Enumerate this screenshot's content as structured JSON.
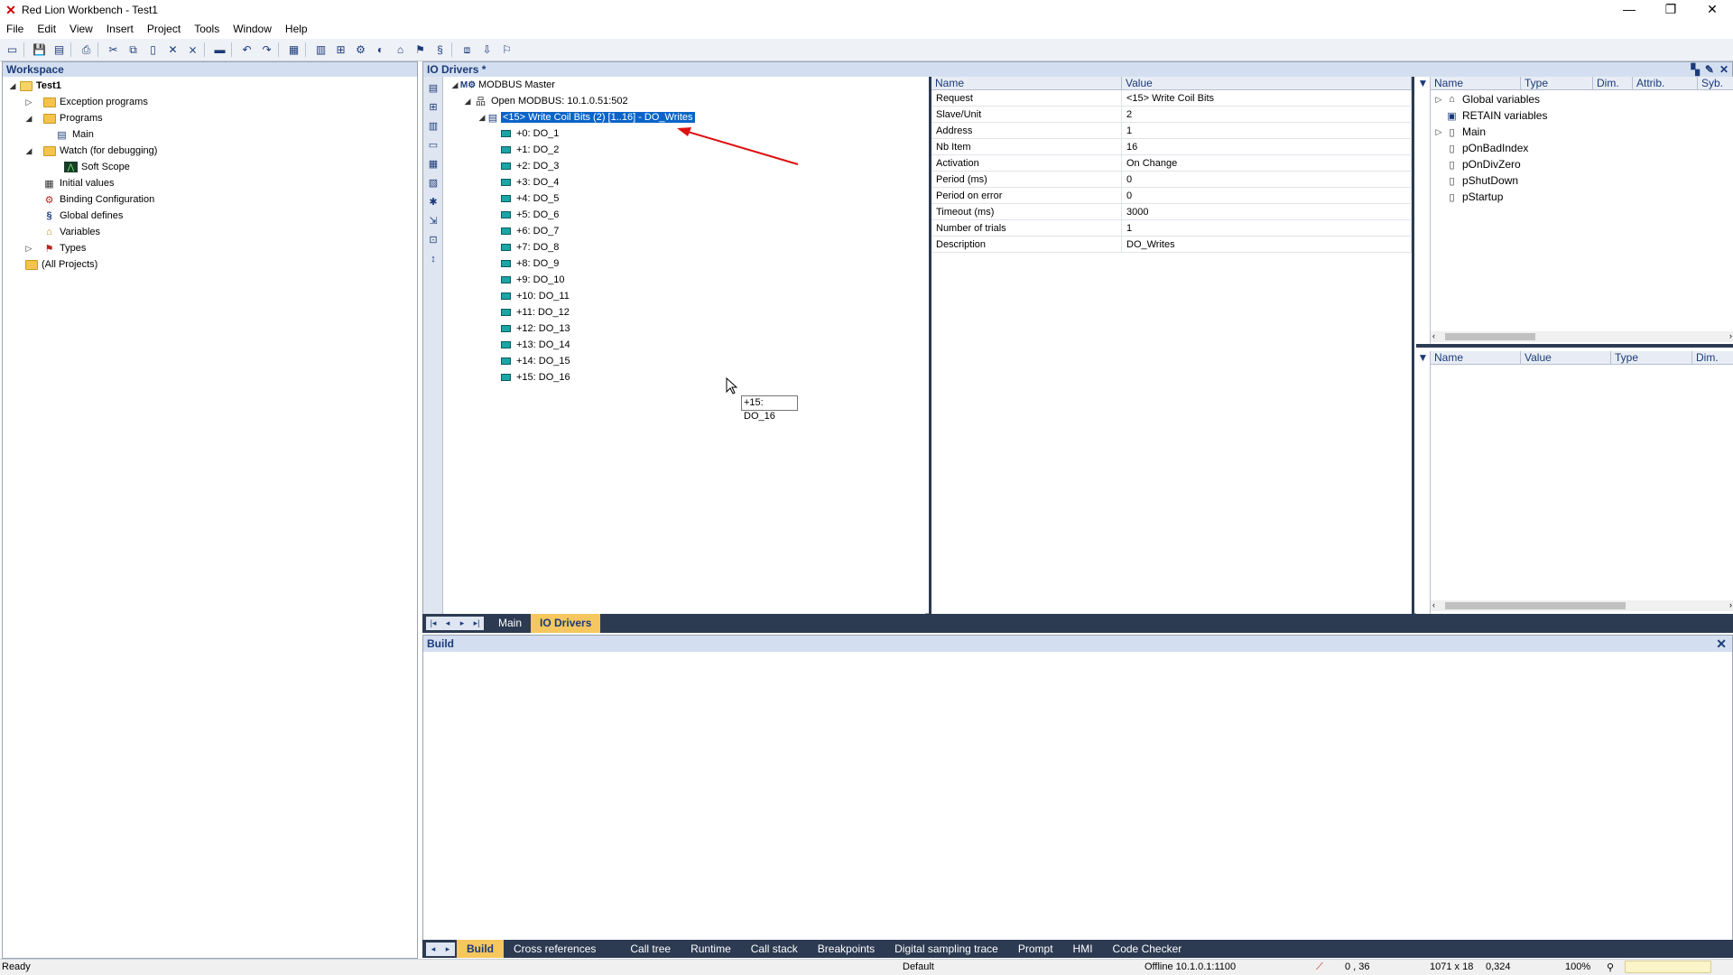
{
  "window": {
    "title": "Red Lion Workbench - Test1",
    "controls": [
      "—",
      "❐",
      "✕"
    ]
  },
  "menu": [
    "File",
    "Edit",
    "View",
    "Insert",
    "Project",
    "Tools",
    "Window",
    "Help"
  ],
  "workspace": {
    "title": "Workspace",
    "items": [
      {
        "label": "Test1",
        "level": 0,
        "expander": "◢",
        "icon": "project-icon"
      },
      {
        "label": "Exception programs",
        "level": 1,
        "expander": "▷",
        "icon": "folder-icon"
      },
      {
        "label": "Programs",
        "level": 1,
        "expander": "◢",
        "icon": "folder-open-icon"
      },
      {
        "label": "Main",
        "level": 2,
        "expander": "",
        "icon": "program-icon"
      },
      {
        "label": "Watch (for debugging)",
        "level": 1,
        "expander": "◢",
        "icon": "folder-open-icon"
      },
      {
        "label": "Soft Scope",
        "level": 2,
        "expander": "",
        "icon": "scope-icon"
      },
      {
        "label": "Initial values",
        "level": 1,
        "expander": "",
        "icon": "table-icon"
      },
      {
        "label": "Binding Configuration",
        "level": 1,
        "expander": "",
        "icon": "binding-icon"
      },
      {
        "label": "Global defines",
        "level": 1,
        "expander": "",
        "icon": "defines-icon"
      },
      {
        "label": "Variables",
        "level": 1,
        "expander": "",
        "icon": "house-icon"
      },
      {
        "label": "Types",
        "level": 1,
        "expander": "▷",
        "icon": "types-icon"
      },
      {
        "label": "(All Projects)",
        "level": 0,
        "expander": "",
        "icon": "folder-icon"
      }
    ]
  },
  "io_drivers": {
    "title": "IO Drivers *",
    "tree": {
      "master": "MODBUS Master",
      "connection": "Open MODBUS: 10.1.0.51:502",
      "request": "<15> Write Coil Bits (2) [1..16] - DO_Writes",
      "coils": [
        "+0: DO_1",
        "+1: DO_2",
        "+2: DO_3",
        "+3: DO_4",
        "+4: DO_5",
        "+5: DO_6",
        "+6: DO_7",
        "+7: DO_8",
        "+8: DO_9",
        "+9: DO_10",
        "+10: DO_11",
        "+11: DO_12",
        "+12: DO_13",
        "+13: DO_14",
        "+14: DO_15",
        "+15: DO_16"
      ]
    },
    "tooltip": "+15: DO_16",
    "properties": {
      "headers": [
        "Name",
        "Value"
      ],
      "rows": [
        {
          "name": "Request",
          "value": "<15> Write Coil Bits"
        },
        {
          "name": "Slave/Unit",
          "value": "2"
        },
        {
          "name": "Address",
          "value": "1"
        },
        {
          "name": "Nb Item",
          "value": "16"
        },
        {
          "name": "Activation",
          "value": "On Change"
        },
        {
          "name": "Period (ms)",
          "value": "0"
        },
        {
          "name": "Period on error",
          "value": "0"
        },
        {
          "name": "Timeout (ms)",
          "value": "3000"
        },
        {
          "name": "Number of trials",
          "value": "1"
        },
        {
          "name": "Description",
          "value": "DO_Writes"
        }
      ]
    },
    "variables": {
      "headers": [
        "Name",
        "Type",
        "Dim.",
        "Attrib.",
        "Syb."
      ],
      "items": [
        {
          "label": "Global variables",
          "expander": "▷",
          "icon": "house-icon"
        },
        {
          "label": "RETAIN variables",
          "expander": "",
          "icon": "retain-icon"
        },
        {
          "label": "Main",
          "expander": "▷",
          "icon": "page-icon"
        },
        {
          "label": "pOnBadIndex",
          "expander": "",
          "icon": "page-icon"
        },
        {
          "label": "pOnDivZero",
          "expander": "",
          "icon": "page-icon"
        },
        {
          "label": "pShutDown",
          "expander": "",
          "icon": "page-icon"
        },
        {
          "label": "pStartup",
          "expander": "",
          "icon": "page-icon"
        }
      ],
      "lower_headers": [
        "Name",
        "Value",
        "Type",
        "Dim."
      ]
    }
  },
  "editor_tabs": [
    "Main",
    "IO Drivers"
  ],
  "build": {
    "title": "Build",
    "tabs": [
      "Build",
      "Cross references",
      "Call tree",
      "Runtime",
      "Call stack",
      "Breakpoints",
      "Digital sampling trace",
      "Prompt",
      "HMI",
      "Code Checker"
    ]
  },
  "status": {
    "ready": "Ready",
    "profile": "Default",
    "connection": "Offline  10.1.0.1:1100",
    "cursor": "0 , 36",
    "size": "1071 x 18",
    "pos": "0,324",
    "zoom": "100%"
  },
  "colors": {
    "panel_header": "#d3dff0",
    "selection": "#0a64c8",
    "dark_tab_bar": "#2c3a52",
    "active_tab": "#f5c75e"
  }
}
